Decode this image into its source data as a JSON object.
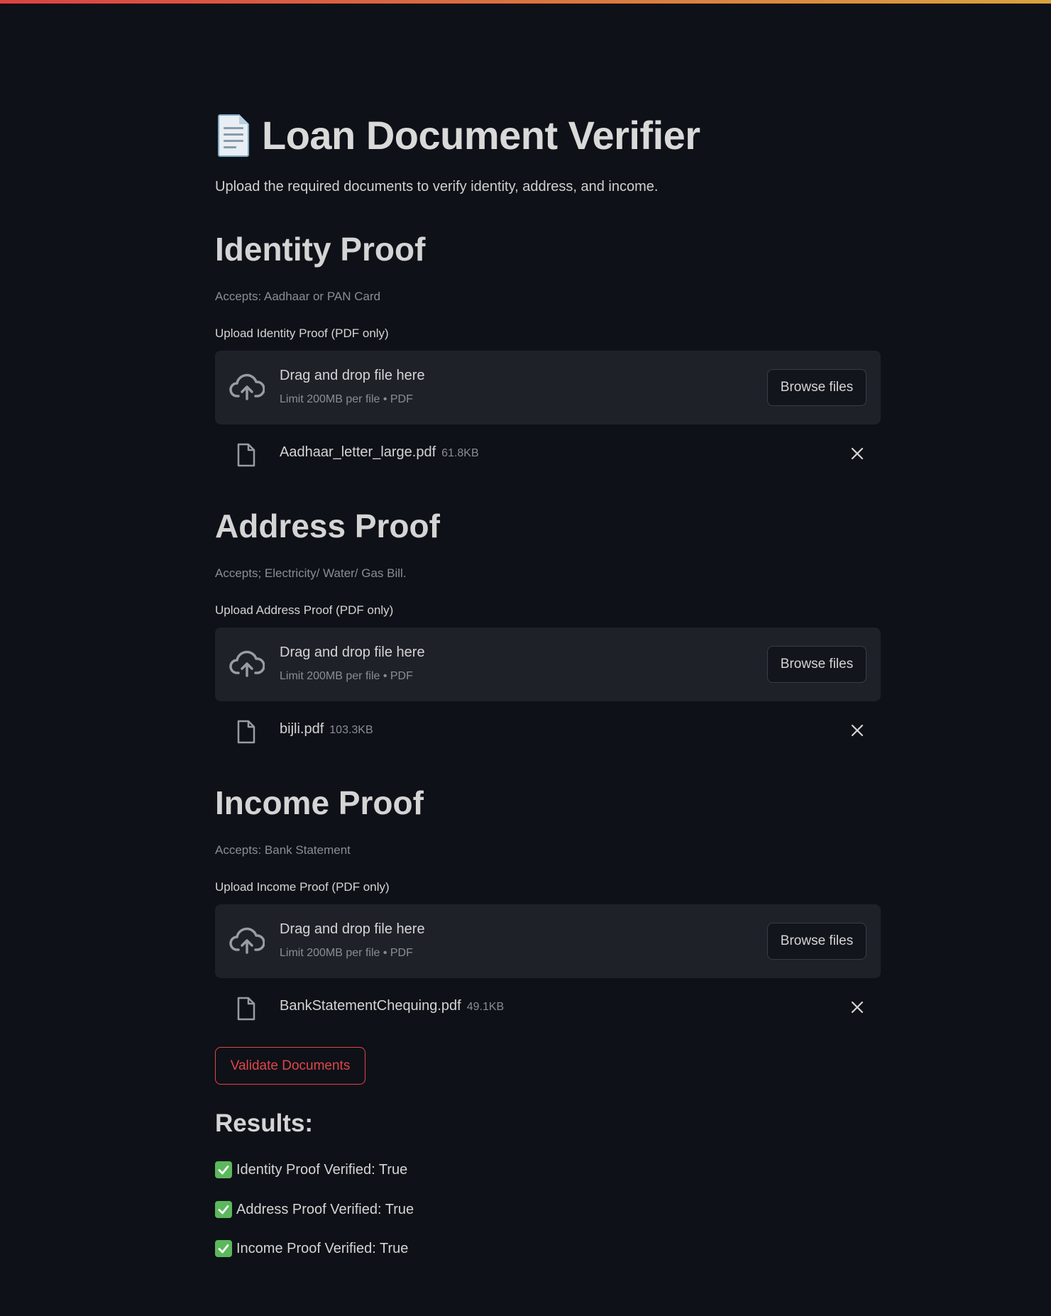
{
  "header": {
    "title": "Loan Document Verifier",
    "emoji": "page-facing-up",
    "subtitle": "Upload the required documents to verify identity, address, and income."
  },
  "sections": [
    {
      "heading": "Identity Proof",
      "accepts": "Accepts: Aadhaar or PAN Card",
      "upload_label": "Upload Identity Proof (PDF only)",
      "drop_title": "Drag and drop file here",
      "drop_limit": "Limit 200MB per file • PDF",
      "browse_label": "Browse files",
      "file": {
        "name": "Aadhaar_letter_large.pdf",
        "size": "61.8KB"
      }
    },
    {
      "heading": "Address Proof",
      "accepts": "Accepts; Electricity/ Water/ Gas Bill.",
      "upload_label": "Upload Address Proof (PDF only)",
      "drop_title": "Drag and drop file here",
      "drop_limit": "Limit 200MB per file • PDF",
      "browse_label": "Browse files",
      "file": {
        "name": "bijli.pdf",
        "size": "103.3KB"
      }
    },
    {
      "heading": "Income Proof",
      "accepts": "Accepts: Bank Statement",
      "upload_label": "Upload Income Proof (PDF only)",
      "drop_title": "Drag and drop file here",
      "drop_limit": "Limit 200MB per file • PDF",
      "browse_label": "Browse files",
      "file": {
        "name": "BankStatementChequing.pdf",
        "size": "49.1KB"
      }
    }
  ],
  "actions": {
    "validate_label": "Validate Documents"
  },
  "results": {
    "heading": "Results:",
    "items": [
      "Identity Proof Verified: True",
      "Address Proof Verified: True",
      "Income Proof Verified: True"
    ]
  },
  "colors": {
    "background": "#0e1117",
    "dropzone": "#1f2129",
    "accent_red": "#e0454b",
    "check_green": "#5cb85c"
  }
}
